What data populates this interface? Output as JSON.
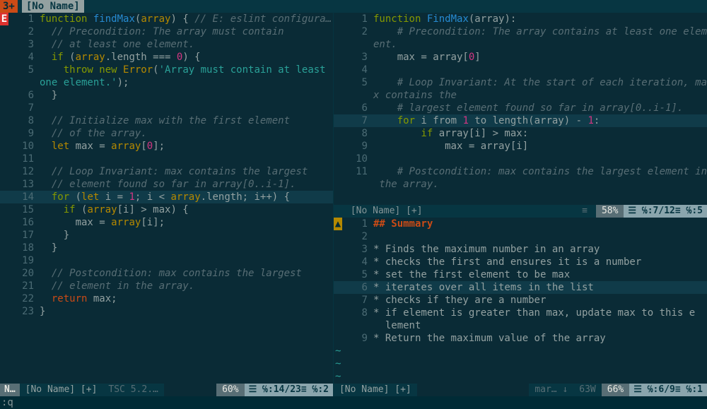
{
  "tabline": {
    "count": "3+",
    "active_tab": "[No Name]"
  },
  "left": {
    "sign_E": "E",
    "lines": [
      {
        "n": "1",
        "cls": "",
        "t": "<span class='kw'>function</span> <span class='func'>findMax</span>(<span class='type'>array</span>) { <span class='com'>// E: eslint configura…</span>"
      },
      {
        "n": "2",
        "cls": "",
        "t": "  <span class='com'>// Precondition: The array must contain</span>"
      },
      {
        "n": "3",
        "cls": "",
        "t": "  <span class='com'>// at least one element.</span>"
      },
      {
        "n": "4",
        "cls": "",
        "t": "  <span class='kw'>if</span> (<span class='type'>array</span>.length === <span class='num2'>0</span>) {"
      },
      {
        "n": "5",
        "cls": "",
        "t": "    <span class='kw'>throw new</span> <span class='type'>Error</span>(<span class='str'>'Array must contain at least </span>"
      },
      {
        "n": "",
        "cls": "",
        "t": "<span class='str'>one element.'</span>);"
      },
      {
        "n": "6",
        "cls": "",
        "t": "  }"
      },
      {
        "n": "7",
        "cls": "",
        "t": ""
      },
      {
        "n": "8",
        "cls": "",
        "t": "  <span class='com'>// Initialize max with the first element</span>"
      },
      {
        "n": "9",
        "cls": "",
        "t": "  <span class='com'>// of the array.</span>"
      },
      {
        "n": "10",
        "cls": "",
        "t": "  <span class='type'>let</span> max = <span class='type'>array</span>[<span class='num2'>0</span>];"
      },
      {
        "n": "11",
        "cls": "",
        "t": ""
      },
      {
        "n": "12",
        "cls": "",
        "t": "  <span class='com'>// Loop Invariant: max contains the largest</span>"
      },
      {
        "n": "13",
        "cls": "",
        "t": "  <span class='com'>// element found so far in array[0..i-1].</span>"
      },
      {
        "n": "14",
        "cls": "hl",
        "t": "  <span class='kw'>for</span> (<span class='type'>let</span> i = <span class='num2'>1</span>; i &lt; <span class='type'>array</span>.length; i++) {"
      },
      {
        "n": "15",
        "cls": "",
        "t": "    <span class='kw'>if</span> (<span class='type'>array</span>[i] &gt; max) {"
      },
      {
        "n": "16",
        "cls": "",
        "t": "      max = <span class='type'>array</span>[i];"
      },
      {
        "n": "17",
        "cls": "",
        "t": "    }"
      },
      {
        "n": "18",
        "cls": "",
        "t": "  }"
      },
      {
        "n": "19",
        "cls": "",
        "t": ""
      },
      {
        "n": "20",
        "cls": "",
        "t": "  <span class='com'>// Postcondition: max contains the largest</span>"
      },
      {
        "n": "21",
        "cls": "",
        "t": "  <span class='com'>// element in the array.</span>"
      },
      {
        "n": "22",
        "cls": "",
        "t": "  <span class='kw2'>return</span> max;"
      },
      {
        "n": "23",
        "cls": "",
        "t": "}"
      }
    ],
    "status": {
      "mode": "N…",
      "file": "[No Name] [+]",
      "type": "TSC 5.2.…",
      "pct": "60%",
      "pos": "☰ ℅:14/23≡ ℅:2"
    }
  },
  "top_right": {
    "lines": [
      {
        "n": "1",
        "cls": "",
        "t": "<span class='kw'>function</span> <span class='func'>FindMax</span>(array):"
      },
      {
        "n": "2",
        "cls": "",
        "t": "    <span class='com'># Precondition: The array contains at least one elem</span>"
      },
      {
        "n": "",
        "cls": "",
        "t": "<span class='com'>ent.</span>"
      },
      {
        "n": "3",
        "cls": "",
        "t": "    max = array[<span class='num2'>0</span>]"
      },
      {
        "n": "4",
        "cls": "",
        "t": ""
      },
      {
        "n": "5",
        "cls": "",
        "t": "    <span class='com'># Loop Invariant: At the start of each iteration, ma</span>"
      },
      {
        "n": "",
        "cls": "",
        "t": "<span class='com'>x contains the</span>"
      },
      {
        "n": "6",
        "cls": "",
        "t": "    <span class='com'># largest element found so far in array[0..i-1].</span>"
      },
      {
        "n": "7",
        "cls": "hl",
        "t": "    <span class='kw'>for</span> i from <span class='num2'>1</span> to length(array) - <span class='num2'>1</span>:"
      },
      {
        "n": "8",
        "cls": "",
        "t": "        <span class='kw'>if</span> array[i] &gt; max:"
      },
      {
        "n": "9",
        "cls": "",
        "t": "            max = array[i]"
      },
      {
        "n": "10",
        "cls": "",
        "t": ""
      },
      {
        "n": "11",
        "cls": "",
        "t": "    <span class='com'># Postcondition: max contains the largest element in</span>"
      },
      {
        "n": "",
        "cls": "",
        "t": "<span class='com'> the array.</span>"
      }
    ],
    "status": {
      "file": "[No Name] [+]",
      "icon": "≡",
      "pct": "58%",
      "pos": "☰ ℅:7/12≡ ℅:5"
    }
  },
  "bottom_right": {
    "sign_W": "▲",
    "lines": [
      {
        "n": "1",
        "cls": "",
        "t": "<span class='mdH'>## Summary</span>"
      },
      {
        "n": "2",
        "cls": "",
        "t": ""
      },
      {
        "n": "3",
        "cls": "",
        "t": "* Finds the maximum number in an array"
      },
      {
        "n": "4",
        "cls": "",
        "t": "* checks the first and ensures it is a number"
      },
      {
        "n": "5",
        "cls": "",
        "t": "* set the first element to be max"
      },
      {
        "n": "6",
        "cls": "hl",
        "t": "* iterates over all items in the list"
      },
      {
        "n": "7",
        "cls": "",
        "t": "* checks if they are a number"
      },
      {
        "n": "8",
        "cls": "",
        "t": "* if element is greater than max, update max to this e"
      },
      {
        "n": "",
        "cls": "",
        "t": "  lement"
      },
      {
        "n": "9",
        "cls": "",
        "t": "* Return the maximum value of the array"
      }
    ],
    "status": {
      "file": "[No Name] [+]",
      "type": "mar… ↓",
      "wc": "63W",
      "pct": "66%",
      "pos": "☰ ℅:6/9≡ ℅:1"
    }
  },
  "cmdline": ":q"
}
